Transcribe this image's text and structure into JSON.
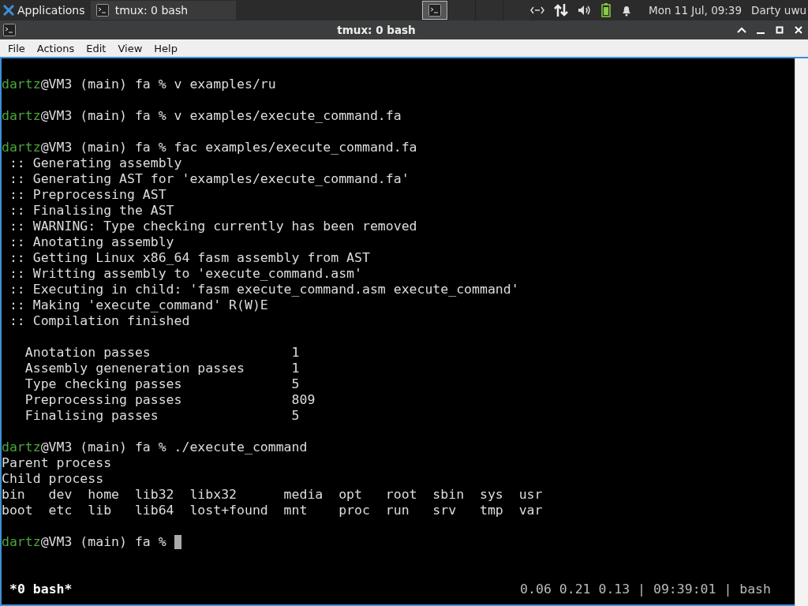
{
  "panel": {
    "apps_label": "Applications",
    "tasks": [
      {
        "label": "tmux: 0 bash",
        "selected": true
      }
    ],
    "workspaces": [
      {
        "selected": true
      },
      {
        "selected": false
      },
      {
        "selected": false
      },
      {
        "selected": false
      }
    ],
    "clock": "Mon 11 Jul, 09:39",
    "user": "Darty uwu"
  },
  "window": {
    "title": "tmux: 0 bash"
  },
  "menu": [
    "File",
    "Actions",
    "Edit",
    "View",
    "Help"
  ],
  "terminal": {
    "lines": [
      {
        "kind": "blank"
      },
      {
        "kind": "prompt",
        "user": "dartz",
        "text": "@VM3 (main) fa % v examples/ru"
      },
      {
        "kind": "blank"
      },
      {
        "kind": "prompt",
        "user": "dartz",
        "text": "@VM3 (main) fa % v examples/execute_command.fa"
      },
      {
        "kind": "blank"
      },
      {
        "kind": "prompt",
        "user": "dartz",
        "text": "@VM3 (main) fa % fac examples/execute_command.fa"
      },
      {
        "kind": "output",
        "text": " :: Generating assembly"
      },
      {
        "kind": "output",
        "text": " :: Generating AST for 'examples/execute_command.fa'"
      },
      {
        "kind": "output",
        "text": " :: Preprocessing AST"
      },
      {
        "kind": "output",
        "text": " :: Finalising the AST"
      },
      {
        "kind": "output",
        "text": " :: WARNING: Type checking currently has been removed"
      },
      {
        "kind": "output",
        "text": " :: Anotating assembly"
      },
      {
        "kind": "output",
        "text": " :: Getting Linux x86_64 fasm assembly from AST"
      },
      {
        "kind": "output",
        "text": " :: Writting assembly to 'execute_command.asm'"
      },
      {
        "kind": "output",
        "text": " :: Executing in child: 'fasm execute_command.asm execute_command'"
      },
      {
        "kind": "output",
        "text": " :: Making 'execute_command' R(W)E"
      },
      {
        "kind": "output",
        "text": " :: Compilation finished"
      },
      {
        "kind": "blank"
      },
      {
        "kind": "output",
        "text": "   Anotation passes                  1"
      },
      {
        "kind": "output",
        "text": "   Assembly geneneration passes      1"
      },
      {
        "kind": "output",
        "text": "   Type checking passes              5"
      },
      {
        "kind": "output",
        "text": "   Preprocessing passes              809"
      },
      {
        "kind": "output",
        "text": "   Finalising passes                 5"
      },
      {
        "kind": "blank"
      },
      {
        "kind": "prompt",
        "user": "dartz",
        "text": "@VM3 (main) fa % ./execute_command"
      },
      {
        "kind": "output",
        "text": "Parent process"
      },
      {
        "kind": "output",
        "text": "Child process"
      },
      {
        "kind": "output",
        "text": "bin   dev  home  lib32  libx32      media  opt   root  sbin  sys  usr"
      },
      {
        "kind": "output",
        "text": "boot  etc  lib   lib64  lost+found  mnt    proc  run   srv   tmp  var"
      },
      {
        "kind": "blank"
      },
      {
        "kind": "prompt",
        "user": "dartz",
        "text": "@VM3 (main) fa % ",
        "cursor": true
      }
    ],
    "status_left": "*0 bash*",
    "status_right": "0.06 0.21 0.13 | 09:39:01 | bash"
  }
}
